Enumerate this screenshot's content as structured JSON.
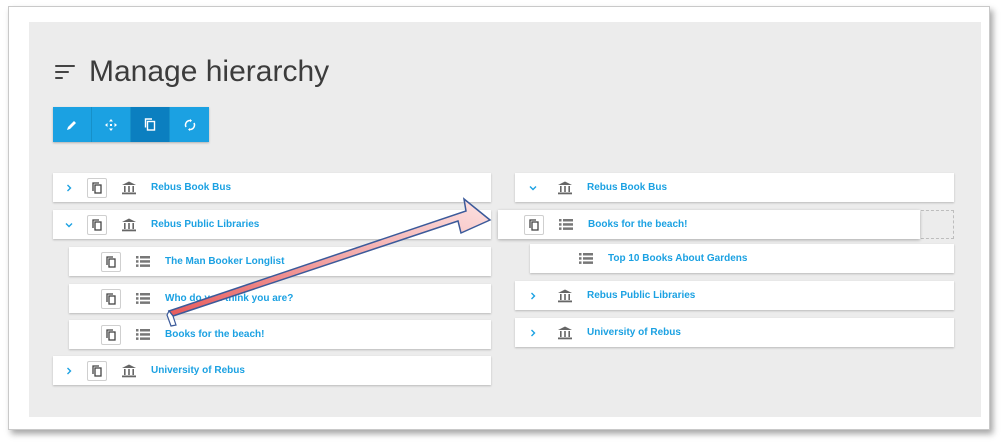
{
  "page": {
    "title": "Manage hierarchy",
    "title_icon": "sort-icon"
  },
  "toolbar": {
    "buttons": [
      {
        "name": "edit",
        "icon": "pencil-icon",
        "active": false
      },
      {
        "name": "move",
        "icon": "move-icon",
        "active": false
      },
      {
        "name": "copy",
        "icon": "copy-icon",
        "active": true
      },
      {
        "name": "refresh",
        "icon": "refresh-icon",
        "active": false
      }
    ]
  },
  "left_tree": [
    {
      "label": "Rebus Book Bus",
      "expander": "chevron-right",
      "type": "library"
    },
    {
      "label": "Rebus Public Libraries",
      "expander": "chevron-down",
      "type": "library"
    },
    {
      "label": "The Man Booker Longlist",
      "expander": "",
      "type": "list"
    },
    {
      "label": "Who do you think you are?",
      "expander": "",
      "type": "list"
    },
    {
      "label": "Books for the beach!",
      "expander": "",
      "type": "list"
    },
    {
      "label": "University of Rebus",
      "expander": "chevron-right",
      "type": "library"
    }
  ],
  "right_tree": [
    {
      "label": "Rebus Book Bus",
      "expander": "chevron-down",
      "type": "library"
    },
    {
      "label": "Books for the beach!",
      "expander": "",
      "type": "list",
      "state": "dragging"
    },
    {
      "label": "Top 10 Books About Gardens",
      "expander": "",
      "type": "list"
    },
    {
      "label": "Rebus Public Libraries",
      "expander": "chevron-right",
      "type": "library"
    },
    {
      "label": "University of Rebus",
      "expander": "chevron-right",
      "type": "library"
    }
  ],
  "colors": {
    "accent": "#1ba1e2",
    "accent_active": "#0b7fc0",
    "panel": "#ececec",
    "arrow_fill": "#f0a0a0",
    "arrow_stroke": "#3b5a9a"
  },
  "overlay": {
    "icon": "drag-arrow"
  }
}
